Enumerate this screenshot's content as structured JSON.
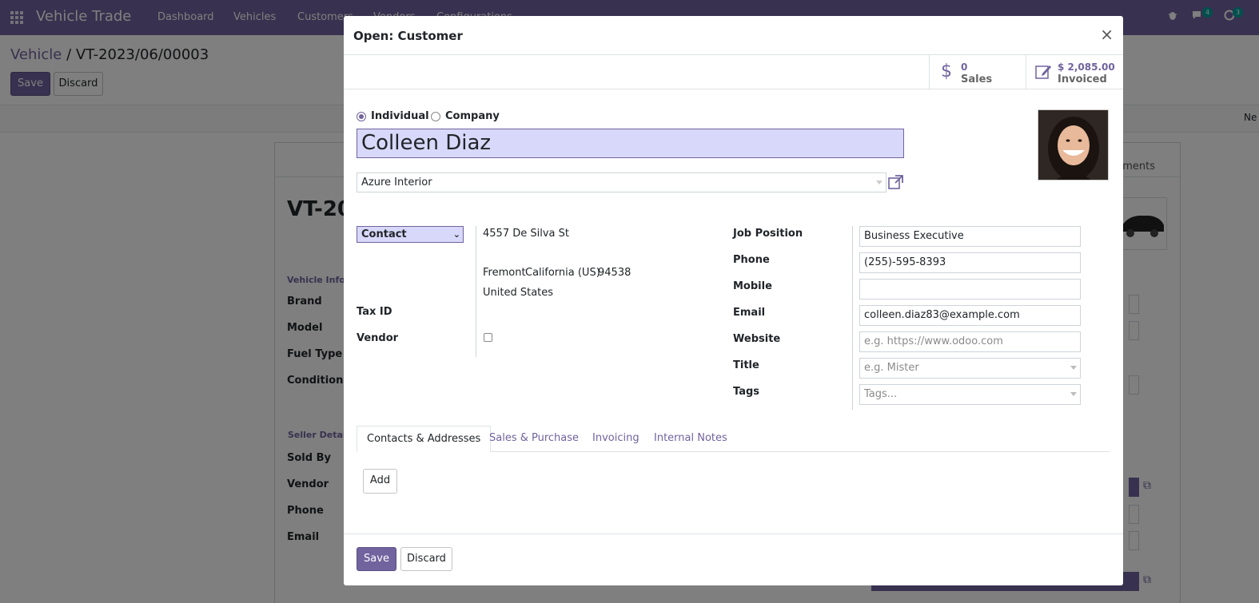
{
  "navbar": {
    "app_title": "Vehicle Trade",
    "menu": [
      "Dashboard",
      "Vehicles",
      "Customers",
      "Vendors",
      "Configurations"
    ],
    "chat_count": "4",
    "activity_count": "3"
  },
  "control": {
    "breadcrumb_parent": "Vehicle",
    "breadcrumb_sep": "/",
    "breadcrumb_current": "VT-2023/06/00003",
    "save_label": "Save",
    "discard_label": "Discard",
    "right_text": "Ne"
  },
  "background": {
    "record_title": "VT-20",
    "tab_documents": "uments",
    "section_vehicle": "Vehicle Inform",
    "labels_vehicle": [
      "Brand",
      "Model",
      "Fuel Type",
      "Condition"
    ],
    "section_seller": "Seller Details",
    "labels_seller": [
      "Sold By",
      "Vendor",
      "Phone",
      "Email"
    ]
  },
  "modal": {
    "title": "Open: Customer",
    "close_glyph": "×",
    "stat_sales": {
      "value": "0",
      "label": "Sales"
    },
    "stat_invoiced": {
      "value": "$ 2,085.00",
      "label": "Invoiced"
    },
    "company_type": {
      "individual": "Individual",
      "company": "Company",
      "selected": "individual"
    },
    "name": "Colleen Diaz",
    "parent_company": "Azure Interior",
    "address_type": "Contact",
    "address": {
      "street": "4557 De Silva St",
      "city": "Fremont",
      "state": "California (US)",
      "zip": "94538",
      "country": "United States"
    },
    "labels": {
      "tax_id": "Tax ID",
      "vendor": "Vendor",
      "job_position": "Job Position",
      "phone": "Phone",
      "mobile": "Mobile",
      "email": "Email",
      "website": "Website",
      "title": "Title",
      "tags": "Tags"
    },
    "values": {
      "job_position": "Business Executive",
      "phone": "(255)-595-8393",
      "mobile": "",
      "email": "colleen.diaz83@example.com"
    },
    "placeholders": {
      "website": "e.g. https://www.odoo.com",
      "title": "e.g. Mister",
      "tags": "Tags..."
    },
    "tabs": [
      "Contacts & Addresses",
      "Sales & Purchase",
      "Invoicing",
      "Internal Notes"
    ],
    "add_label": "Add",
    "save_label": "Save",
    "discard_label": "Discard"
  }
}
